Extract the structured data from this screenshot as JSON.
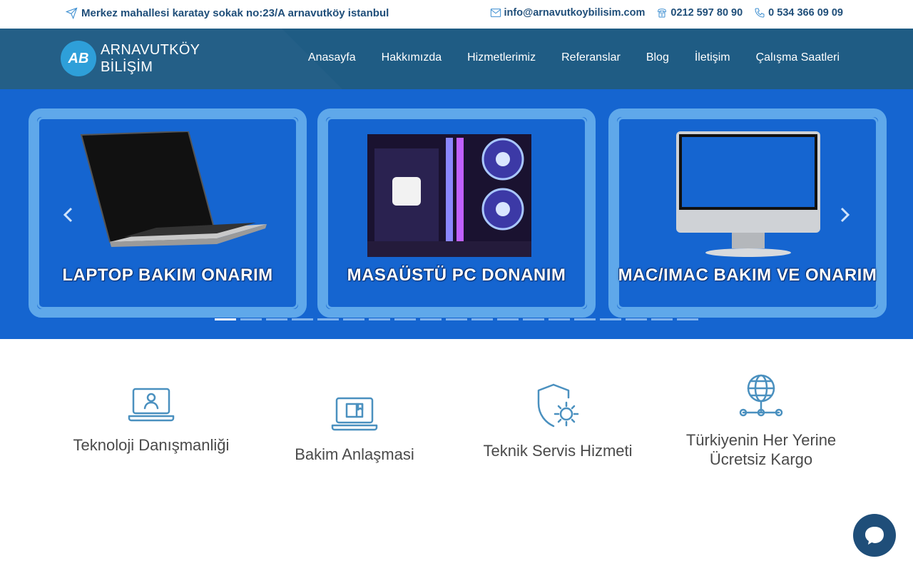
{
  "topbar": {
    "address": "Merkez mahallesi karatay sokak no:23/A arnavutköy istanbul",
    "email": "info@arnavutkoybilisim.com",
    "phone1": "0212 597 80 90",
    "phone2": "0 534 366 09 09"
  },
  "brand": {
    "logo_mark": "AB",
    "line1": "ARNAVUTKÖY",
    "line2": "BİLİŞİM"
  },
  "nav": {
    "items": [
      "Anasayfa",
      "Hakkımızda",
      "Hizmetlerimiz",
      "Referanslar",
      "Blog",
      "İletişim",
      "Çalışma Saatleri"
    ]
  },
  "slider": {
    "slides": [
      {
        "caption": "LAPTOP BAKIM ONARIM",
        "icon": "laptop-image"
      },
      {
        "caption": "MASAÜSTÜ PC DONANIM",
        "icon": "desktop-pc-image"
      },
      {
        "caption": "MAC/IMAC BAKIM VE ONARIM",
        "icon": "imac-image"
      }
    ],
    "prev_icon": "chevron-left-icon",
    "next_icon": "chevron-right-icon",
    "dot_count": 19,
    "active_dot": 0
  },
  "features": [
    {
      "title": "Teknoloji Danışmanliği",
      "icon": "laptop-user-icon"
    },
    {
      "title": "Bakim Anlaşmasi",
      "icon": "laptop-book-icon"
    },
    {
      "title": "Teknik Servis Hizmeti",
      "icon": "shield-gear-icon"
    },
    {
      "title": "Türkiyenin Her Yerine Ücretsiz Kargo",
      "icon": "globe-network-icon"
    }
  ],
  "colors": {
    "primary_dark": "#1f4e79",
    "navbar": "#1f5c84",
    "slider_bg": "#1565d0",
    "card_frame": "#5fa8ea",
    "icon_stroke": "#4a90bf"
  },
  "chat": {
    "icon": "chat-bubble-icon"
  }
}
